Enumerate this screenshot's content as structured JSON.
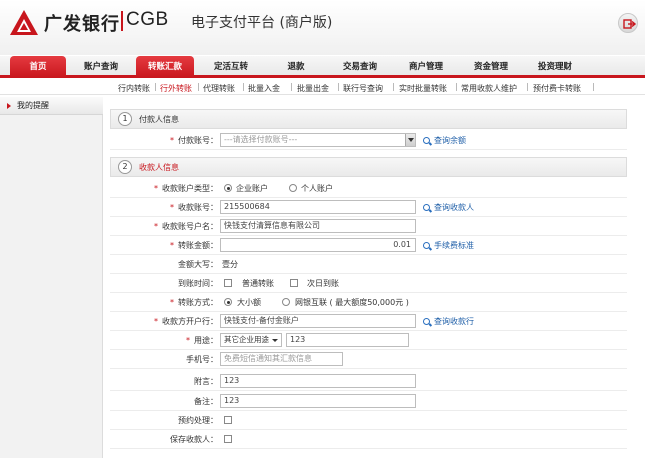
{
  "header": {
    "bank_name": "广发银行",
    "bank_code": "CGB",
    "platform": "电子支付平台 (商户版)",
    "brand_color": "#c8161d",
    "logout_icon": "logout-icon"
  },
  "nav": {
    "items": [
      "首页",
      "账户查询",
      "转账汇款",
      "定活互转",
      "退款",
      "交易查询",
      "商户管理",
      "资金管理",
      "投资理财"
    ],
    "active": "转账汇款"
  },
  "subnav": {
    "items": [
      "行内转账",
      "行外转账",
      "代理转账",
      "批量入金",
      "批量出金",
      "联行号查询",
      "实时批量转账",
      "常用收款人维护",
      "预付费卡转账"
    ],
    "active": "行外转账"
  },
  "sidebar": {
    "items": [
      {
        "label": "我的提醒"
      }
    ]
  },
  "payer": {
    "num": "1",
    "title": "付款人信息",
    "account_label": "付款账号：",
    "account_placeholder": "---请选择付款账号---",
    "balance_link": "查询余额"
  },
  "payee": {
    "num": "2",
    "title": "收款人信息",
    "type_label": "收款账户类型：",
    "type_options": [
      "企业账户",
      "个人账户"
    ],
    "type_selected": "企业账户",
    "account_label": "收款账号：",
    "account_value": "215500684",
    "account_link": "查询收款人",
    "name_label": "收款账号户名：",
    "name_value": "快钱支付清算信息有限公司",
    "amount_label": "转账金额：",
    "amount_value": "0.01",
    "fee_link": "手续费标准",
    "uppercase_label": "金额大写：",
    "uppercase_value": "壹分",
    "arrival_label": "到账时间：",
    "arrival_options": [
      "普通转账",
      "次日到账"
    ],
    "method_label": "转账方式：",
    "method_options": [
      "大小额",
      "网银互联 ( 最大额度50,000元 )"
    ],
    "method_selected": "大小额",
    "bank_label": "收款方开户行：",
    "bank_value": "快钱支付-备付金账户",
    "bank_link": "查询收款行",
    "usage_label": "用途：",
    "usage_select": "其它企业用途",
    "usage_value": "123",
    "phone_label": "手机号：",
    "phone_placeholder": "免费短信通知其汇款信息",
    "postscript_label": "附言：",
    "postscript_value": "123",
    "remark_label": "备注：",
    "remark_value": "123",
    "schedule_label": "预约处理：",
    "save_label": "保存收款人："
  }
}
